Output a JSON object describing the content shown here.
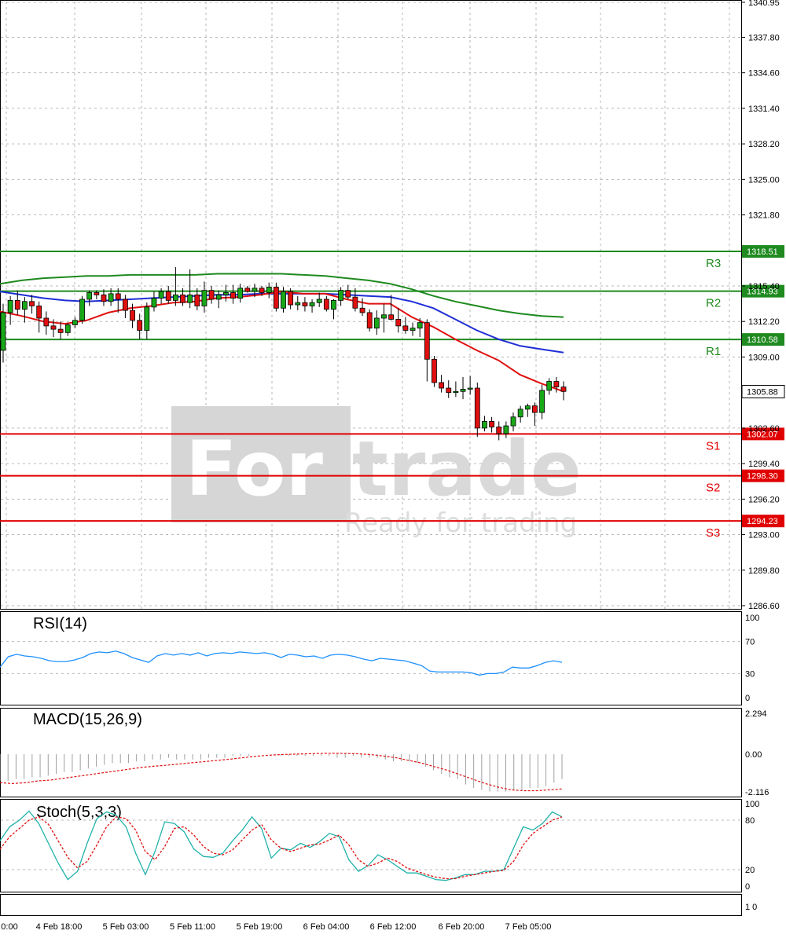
{
  "chart_data": {
    "type": "candlestick",
    "watermark": {
      "brand_a": "For",
      "brand_b": "trade",
      "tagline": "Ready for trading"
    },
    "price_axis": {
      "ticks": [
        "1340.95",
        "1337.80",
        "1334.60",
        "1331.40",
        "1328.20",
        "1325.00",
        "1321.80",
        "1315.40",
        "1312.20",
        "1309.00",
        "1302.60",
        "1299.40",
        "1296.20",
        "1293.00",
        "1289.80",
        "1286.60"
      ],
      "range": [
        1286.6,
        1342.0
      ],
      "current_price": "1305.88"
    },
    "time_axis": [
      "0:00",
      "4 Feb 18:00",
      "5 Feb 03:00",
      "5 Feb 11:00",
      "5 Feb 19:00",
      "6 Feb 04:00",
      "6 Feb 12:00",
      "6 Feb 20:00",
      "7 Feb 05:00"
    ],
    "levels": [
      {
        "name": "R3",
        "value": "1318.51",
        "color": "#1f8a1f"
      },
      {
        "name": "R2",
        "value": "1314.93",
        "color": "#1f8a1f"
      },
      {
        "name": "R1",
        "value": "1310.58",
        "color": "#1f8a1f"
      },
      {
        "name": "S1",
        "value": "1302.07",
        "color": "#e00000"
      },
      {
        "name": "S2",
        "value": "1298.30",
        "color": "#e00000"
      },
      {
        "name": "S3",
        "value": "1294.23",
        "color": "#e00000"
      }
    ],
    "candles": [
      [
        1309.6,
        1313.8,
        1308.5,
        1313.0
      ],
      [
        1313.0,
        1314.5,
        1311.9,
        1314.1
      ],
      [
        1314.1,
        1315.0,
        1312.8,
        1313.3
      ],
      [
        1313.3,
        1314.4,
        1312.1,
        1314.0
      ],
      [
        1314.0,
        1314.6,
        1312.9,
        1313.6
      ],
      [
        1313.6,
        1314.0,
        1311.2,
        1312.5
      ],
      [
        1312.5,
        1313.1,
        1311.0,
        1311.8
      ],
      [
        1311.8,
        1312.4,
        1310.8,
        1311.5
      ],
      [
        1311.5,
        1312.2,
        1310.6,
        1311.2
      ],
      [
        1311.2,
        1312.1,
        1310.9,
        1311.9
      ],
      [
        1311.9,
        1312.6,
        1311.6,
        1312.3
      ],
      [
        1312.3,
        1314.5,
        1312.0,
        1314.2
      ],
      [
        1314.2,
        1315.0,
        1313.6,
        1314.8
      ],
      [
        1314.8,
        1315.0,
        1314.2,
        1314.6
      ],
      [
        1314.6,
        1315.1,
        1313.6,
        1314.0
      ],
      [
        1314.0,
        1315.2,
        1313.6,
        1314.7
      ],
      [
        1314.7,
        1315.2,
        1313.0,
        1314.2
      ],
      [
        1314.2,
        1314.6,
        1312.5,
        1313.2
      ],
      [
        1313.2,
        1313.8,
        1311.6,
        1312.3
      ],
      [
        1312.3,
        1312.9,
        1310.6,
        1311.4
      ],
      [
        1311.4,
        1313.9,
        1310.6,
        1313.5
      ],
      [
        1313.5,
        1314.9,
        1313.1,
        1314.3
      ],
      [
        1314.3,
        1315.2,
        1313.8,
        1314.9
      ],
      [
        1314.9,
        1315.4,
        1313.8,
        1314.1
      ],
      [
        1314.1,
        1317.1,
        1313.6,
        1314.6
      ],
      [
        1314.6,
        1315.2,
        1313.6,
        1313.9
      ],
      [
        1313.9,
        1316.9,
        1313.4,
        1314.6
      ],
      [
        1314.6,
        1315.2,
        1313.2,
        1313.6
      ],
      [
        1313.6,
        1315.8,
        1313.0,
        1315.0
      ],
      [
        1315.0,
        1315.4,
        1313.8,
        1314.2
      ],
      [
        1314.2,
        1315.0,
        1313.4,
        1314.6
      ],
      [
        1314.6,
        1315.5,
        1314.0,
        1314.8
      ],
      [
        1314.8,
        1315.5,
        1313.8,
        1314.3
      ],
      [
        1314.3,
        1315.6,
        1313.9,
        1315.2
      ],
      [
        1315.2,
        1315.4,
        1314.8,
        1314.9
      ],
      [
        1314.9,
        1315.6,
        1314.4,
        1315.2
      ],
      [
        1315.2,
        1315.4,
        1314.5,
        1314.8
      ],
      [
        1314.8,
        1315.7,
        1314.3,
        1315.3
      ],
      [
        1315.3,
        1315.7,
        1313.1,
        1313.4
      ],
      [
        1313.4,
        1315.3,
        1313.0,
        1314.9
      ],
      [
        1314.9,
        1315.2,
        1313.3,
        1313.7
      ],
      [
        1313.7,
        1314.5,
        1313.2,
        1313.9
      ],
      [
        1313.9,
        1314.4,
        1313.1,
        1313.6
      ],
      [
        1313.6,
        1314.2,
        1313.0,
        1313.9
      ],
      [
        1313.9,
        1314.8,
        1313.5,
        1314.2
      ],
      [
        1314.2,
        1314.5,
        1313.1,
        1313.3
      ],
      [
        1313.3,
        1314.2,
        1312.4,
        1314.1
      ],
      [
        1314.1,
        1315.3,
        1313.6,
        1315.0
      ],
      [
        1315.0,
        1315.5,
        1314.2,
        1314.4
      ],
      [
        1314.4,
        1315.2,
        1313.1,
        1313.4
      ],
      [
        1313.4,
        1314.3,
        1312.7,
        1313.0
      ],
      [
        1313.0,
        1313.3,
        1311.3,
        1311.6
      ],
      [
        1311.6,
        1313.2,
        1311.0,
        1312.5
      ],
      [
        1312.5,
        1313.8,
        1311.2,
        1312.8
      ],
      [
        1312.8,
        1314.6,
        1312.3,
        1312.4
      ],
      [
        1312.4,
        1313.4,
        1311.2,
        1311.8
      ],
      [
        1311.8,
        1312.6,
        1311.1,
        1311.4
      ],
      [
        1311.4,
        1312.1,
        1310.9,
        1311.6
      ],
      [
        1311.6,
        1312.5,
        1310.8,
        1312.1
      ],
      [
        1312.1,
        1312.4,
        1306.8,
        1308.8
      ],
      [
        1308.8,
        1309.1,
        1306.3,
        1306.7
      ],
      [
        1306.7,
        1307.4,
        1305.8,
        1306.2
      ],
      [
        1306.2,
        1306.9,
        1305.3,
        1305.8
      ],
      [
        1305.8,
        1306.8,
        1305.4,
        1305.9
      ],
      [
        1305.9,
        1307.2,
        1305.2,
        1306.1
      ],
      [
        1306.1,
        1307.3,
        1305.6,
        1306.2
      ],
      [
        1306.2,
        1306.7,
        1301.8,
        1302.6
      ],
      [
        1302.6,
        1303.7,
        1302.3,
        1303.2
      ],
      [
        1303.2,
        1303.6,
        1302.2,
        1302.7
      ],
      [
        1302.7,
        1303.2,
        1301.5,
        1302.1
      ],
      [
        1302.1,
        1303.2,
        1301.7,
        1302.8
      ],
      [
        1302.8,
        1304.0,
        1302.3,
        1303.6
      ],
      [
        1303.6,
        1304.6,
        1303.1,
        1304.3
      ],
      [
        1304.3,
        1304.8,
        1303.6,
        1304.6
      ],
      [
        1304.6,
        1304.9,
        1302.8,
        1304.0
      ],
      [
        1304.0,
        1306.5,
        1303.4,
        1306.0
      ],
      [
        1306.0,
        1307.1,
        1305.6,
        1306.8
      ],
      [
        1306.8,
        1307.2,
        1305.8,
        1306.3
      ],
      [
        1306.3,
        1306.8,
        1305.1,
        1305.9
      ]
    ],
    "ma_fast": [
      1313.1,
      1312.7,
      1312.2,
      1312.0,
      1312.3,
      1313.0,
      1313.4,
      1313.6,
      1313.9,
      1314.0,
      1314.3,
      1314.4,
      1314.6,
      1314.9,
      1314.7,
      1314.7,
      1314.2,
      1313.8,
      1313.8,
      1312.6,
      1311.7,
      1310.6,
      1309.6,
      1308.7,
      1307.4,
      1306.6,
      1305.9
    ],
    "ma_mid": [
      1314.9,
      1314.6,
      1314.3,
      1314.1,
      1314.0,
      1314.1,
      1314.2,
      1314.3,
      1314.4,
      1314.5,
      1314.6,
      1314.6,
      1314.7,
      1314.7,
      1314.7,
      1314.7,
      1314.6,
      1314.5,
      1314.4,
      1314.0,
      1313.4,
      1312.4,
      1311.4,
      1310.6,
      1310.0,
      1309.7,
      1309.4
    ],
    "ma_slow": [
      1315.6,
      1315.9,
      1316.1,
      1316.2,
      1316.3,
      1316.3,
      1316.4,
      1316.4,
      1316.4,
      1316.4,
      1316.5,
      1316.5,
      1316.5,
      1316.5,
      1316.4,
      1316.3,
      1316.1,
      1315.9,
      1315.6,
      1315.1,
      1314.5,
      1314.0,
      1313.6,
      1313.2,
      1312.9,
      1312.7,
      1312.6
    ],
    "rsi": {
      "label": "RSI(14)",
      "ticks": [
        "100",
        "70",
        "30",
        "0"
      ],
      "values": [
        38,
        51,
        54,
        52,
        51,
        49,
        46,
        45,
        45,
        47,
        50,
        55,
        57,
        56,
        58,
        55,
        50,
        47,
        44,
        52,
        55,
        53,
        55,
        53,
        56,
        52,
        55,
        56,
        55,
        57,
        56,
        55,
        56,
        54,
        50,
        54,
        53,
        51,
        52,
        49,
        53,
        54,
        53,
        51,
        48,
        46,
        49,
        48,
        47,
        46,
        43,
        40,
        33,
        32,
        32,
        32,
        32,
        31,
        28,
        30,
        30,
        32,
        38,
        37,
        37,
        40,
        44,
        46,
        44
      ]
    },
    "macd": {
      "label": "MACD(15,26,9)",
      "ticks": [
        "2.294",
        "0.00",
        "-2.116"
      ],
      "hist": [
        -1.5,
        -1.5,
        -1.4,
        -1.4,
        -1.3,
        -1.3,
        -1.2,
        -1.1,
        -1.0,
        -1.0,
        -0.9,
        -0.8,
        -0.7,
        -0.6,
        -0.5,
        -0.5,
        -0.5,
        -0.4,
        -0.4,
        -0.3,
        -0.3,
        -0.2,
        -0.3,
        -0.3,
        -0.3,
        -0.3,
        -0.2,
        -0.2,
        -0.2,
        -0.1,
        -0.1,
        -0.1,
        0.0,
        0.0,
        0.0,
        -0.1,
        -0.1,
        -0.1,
        -0.1,
        -0.1,
        -0.1,
        -0.1,
        -0.2,
        -0.2,
        -0.1,
        -0.2,
        -0.2,
        -0.2,
        -0.3,
        -0.4,
        -0.4,
        -0.4,
        -0.5,
        -0.7,
        -0.9,
        -1.1,
        -1.3,
        -1.4,
        -1.7,
        -1.9,
        -2.0,
        -2.1,
        -2.1,
        -2.1,
        -2.0,
        -2.0,
        -1.9,
        -1.9,
        -1.8,
        -1.6,
        -1.4
      ],
      "signal": [
        -1.6,
        -1.65,
        -1.6,
        -1.5,
        -1.45,
        -1.35,
        -1.25,
        -1.15,
        -1.05,
        -0.95,
        -0.85,
        -0.75,
        -0.68,
        -0.62,
        -0.55,
        -0.48,
        -0.42,
        -0.35,
        -0.28,
        -0.2,
        -0.12,
        -0.06,
        -0.02,
        0.0,
        0.02,
        0.04,
        0.05,
        0.04,
        0.02,
        -0.02,
        -0.1,
        -0.2,
        -0.35,
        -0.5,
        -0.7,
        -0.9,
        -1.15,
        -1.4,
        -1.65,
        -1.85,
        -2.0,
        -2.05,
        -2.05,
        -2.0,
        -1.95
      ]
    },
    "stoch": {
      "label": "Stoch(5,3,3)",
      "ticks": [
        "100",
        "80",
        "20",
        "0"
      ],
      "k": [
        55,
        72,
        80,
        91,
        76,
        52,
        28,
        8,
        18,
        52,
        82,
        90,
        86,
        72,
        40,
        14,
        42,
        78,
        76,
        66,
        45,
        36,
        35,
        40,
        55,
        68,
        84,
        70,
        34,
        46,
        44,
        52,
        47,
        54,
        64,
        60,
        32,
        18,
        25,
        38,
        32,
        24,
        16,
        16,
        12,
        8,
        7,
        10,
        14,
        14,
        18,
        18,
        20,
        46,
        72,
        68,
        76,
        90,
        84
      ],
      "d": [
        45,
        60,
        70,
        80,
        84,
        75,
        55,
        35,
        22,
        30,
        50,
        72,
        84,
        82,
        68,
        42,
        32,
        48,
        70,
        72,
        62,
        48,
        40,
        38,
        44,
        56,
        68,
        75,
        56,
        46,
        42,
        46,
        50,
        51,
        56,
        62,
        50,
        32,
        24,
        28,
        34,
        30,
        22,
        18,
        14,
        11,
        9,
        9,
        12,
        14,
        16,
        18,
        19,
        30,
        50,
        64,
        72,
        80,
        84
      ]
    },
    "sub_axis_label": "1 0"
  }
}
